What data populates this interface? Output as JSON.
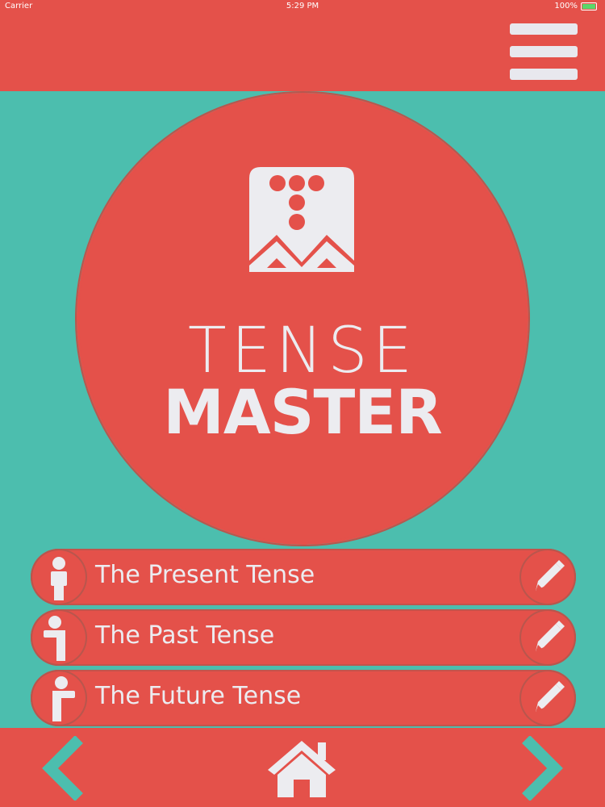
{
  "status_bar": {
    "carrier": "Carrier",
    "time": "5:29 PM",
    "battery": "100%"
  },
  "header": {
    "menu_icon": "hamburger-menu-icon"
  },
  "logo": {
    "title_line1": "TENSE",
    "title_line2": "MASTER"
  },
  "tenses": [
    {
      "label": "The Present Tense",
      "icon": "person-standing-icon",
      "action_icon": "pencil-icon"
    },
    {
      "label": "The Past Tense",
      "icon": "person-arm-back-icon",
      "action_icon": "pencil-icon"
    },
    {
      "label": "The Future Tense",
      "icon": "person-arm-forward-icon",
      "action_icon": "pencil-icon"
    }
  ],
  "footer": {
    "prev_icon": "chevron-left-icon",
    "home_icon": "home-icon",
    "next_icon": "chevron-right-icon"
  },
  "colors": {
    "background_teal": "#4cbeae",
    "primary_red": "#e4514a",
    "text_light": "#ececf0"
  }
}
